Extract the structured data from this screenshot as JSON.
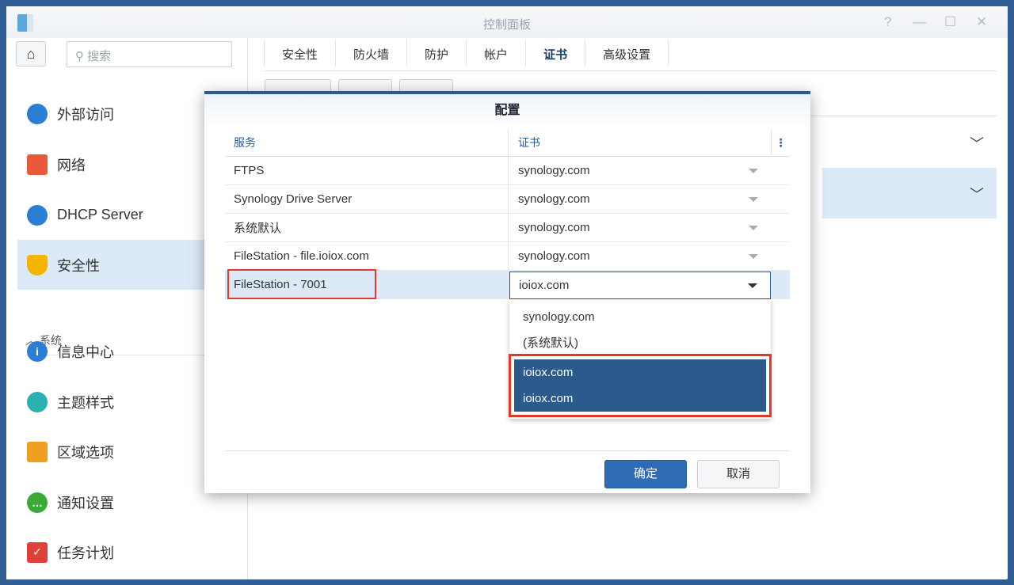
{
  "window": {
    "title": "控制面板",
    "help": "?",
    "minimize": "—",
    "maximize": "☐",
    "close": "✕"
  },
  "sidebar": {
    "search_placeholder": "搜索",
    "group": "系统",
    "items": [
      {
        "label": "外部访问",
        "color": "#2a7fd4"
      },
      {
        "label": "网络",
        "color": "#e85a3a"
      },
      {
        "label": "DHCP Server",
        "color": "#2a7fd4"
      },
      {
        "label": "安全性",
        "color": "#f4b400"
      },
      {
        "label": "信息中心",
        "color": "#2a7fd4"
      },
      {
        "label": "主题样式",
        "color": "#2ab0b0"
      },
      {
        "label": "区域选项",
        "color": "#f0a020"
      },
      {
        "label": "通知设置",
        "color": "#3aaa35"
      },
      {
        "label": "任务计划",
        "color": "#e0403a"
      }
    ]
  },
  "tabs": [
    "安全性",
    "防火墙",
    "防护",
    "帐户",
    "证书",
    "高级设置"
  ],
  "active_tab": "证书",
  "dialog": {
    "title": "配置",
    "col_service": "服务",
    "col_cert": "证书",
    "rows": [
      {
        "service": "FTPS",
        "cert": "synology.com"
      },
      {
        "service": "Synology Drive Server",
        "cert": "synology.com"
      },
      {
        "service": "系统默认",
        "cert": "synology.com"
      },
      {
        "service": "FileStation - file.ioiox.com",
        "cert": "synology.com"
      },
      {
        "service": "FileStation - 7001",
        "cert": "ioiox.com"
      }
    ],
    "options": [
      "synology.com",
      "(系统默认)",
      "ioiox.com",
      "ioiox.com"
    ],
    "ok": "确定",
    "cancel": "取消"
  },
  "colors": {
    "accent": "#2d5a8c",
    "highlight": "#e03b2a",
    "selected": "#dce9f7"
  }
}
